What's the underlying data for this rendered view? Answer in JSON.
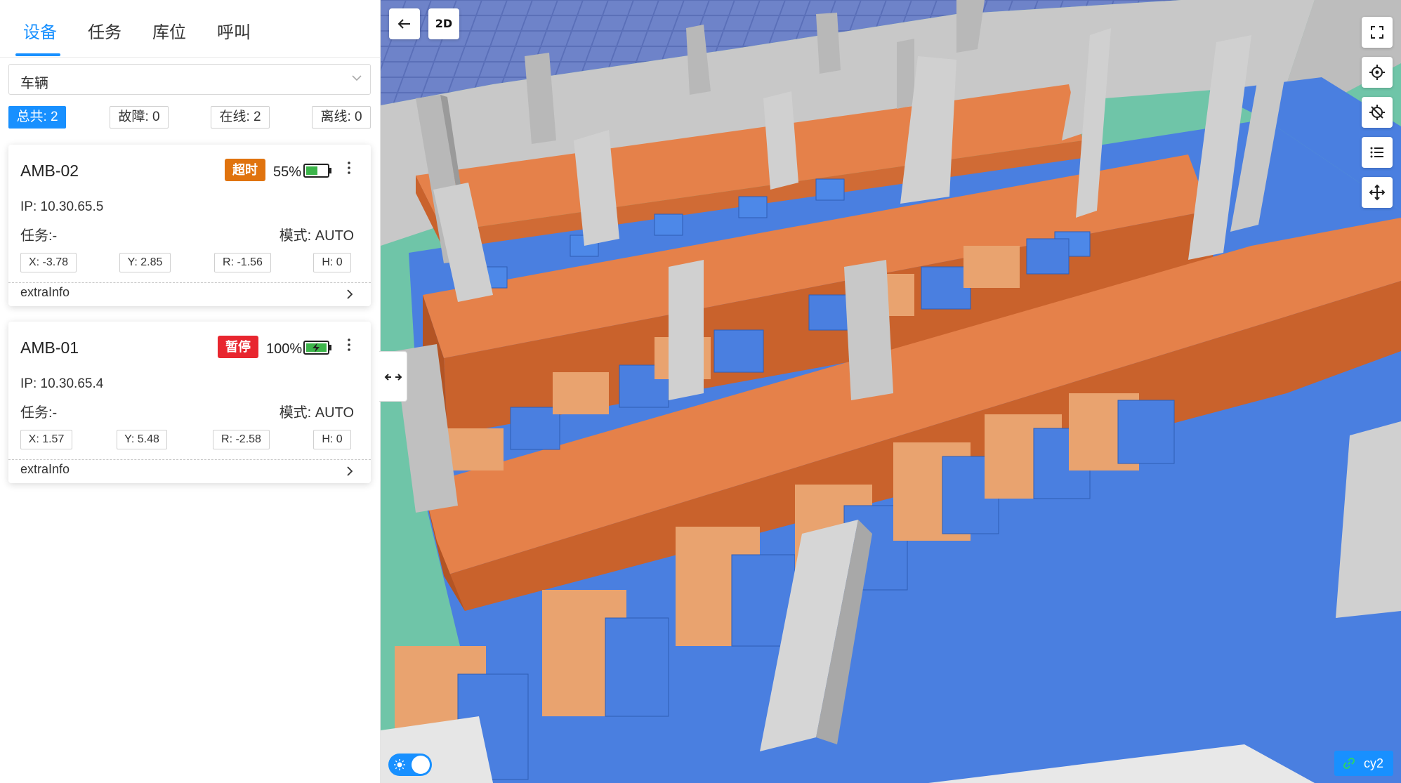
{
  "tabs": [
    {
      "label": "设备",
      "active": true
    },
    {
      "label": "任务",
      "active": false
    },
    {
      "label": "库位",
      "active": false
    },
    {
      "label": "呼叫",
      "active": false
    }
  ],
  "filter": {
    "selected": "车辆"
  },
  "stats": {
    "total": "总共: 2",
    "fault": "故障: 0",
    "online": "在线: 2",
    "offline": "离线: 0"
  },
  "vehicles": [
    {
      "name": "AMB-02",
      "status": "超时",
      "status_color": "#e0730e",
      "battery": "55%",
      "battery_level": 0.55,
      "charging": false,
      "ip": "IP: 10.30.65.5",
      "task": "任务:-",
      "mode": "模式: AUTO",
      "x": "X: -3.78",
      "y": "Y: 2.85",
      "r": "R: -1.56",
      "h": "H: 0",
      "extra": "extraInfo"
    },
    {
      "name": "AMB-01",
      "status": "暂停",
      "status_color": "#e8262f",
      "battery": "100%",
      "battery_level": 1.0,
      "charging": true,
      "ip": "IP: 10.30.65.4",
      "task": "任务:-",
      "mode": "模式: AUTO",
      "x": "X: 1.57",
      "y": "Y: 5.48",
      "r": "R: -2.58",
      "h": "H: 0",
      "extra": "extraInfo"
    }
  ],
  "viewport": {
    "mode_button": "2D",
    "theme": "light",
    "scene_tag": "cy2"
  },
  "colors": {
    "accent": "#1890ff",
    "floor": "#4a7fe0",
    "ground": "#6fc5a8",
    "shelf": "#e5814a"
  }
}
